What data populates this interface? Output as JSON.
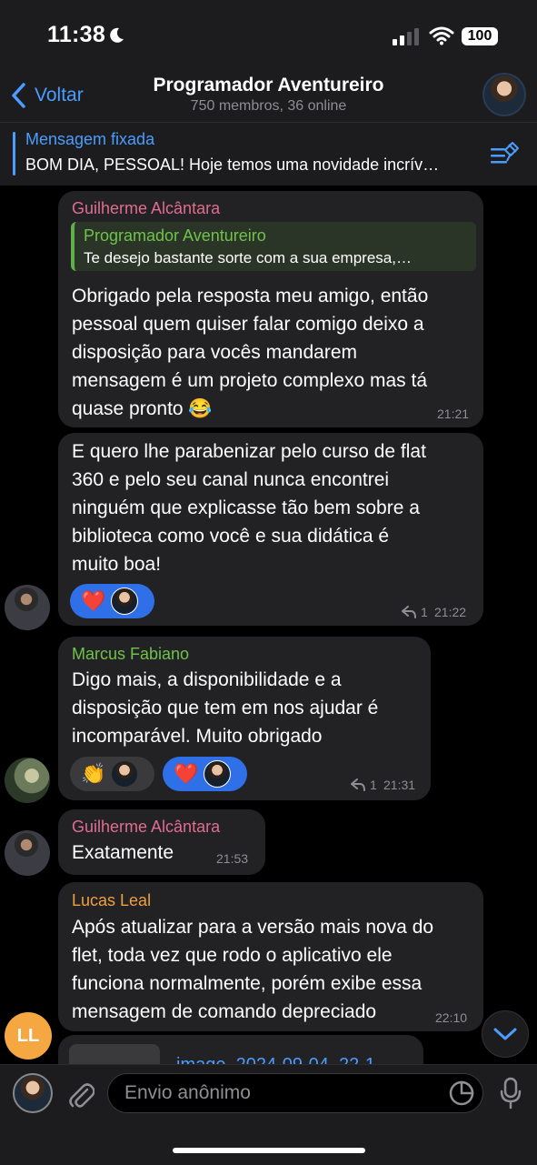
{
  "status": {
    "time": "11:38",
    "battery": "100"
  },
  "header": {
    "back_label": "Voltar",
    "title": "Programador Aventureiro",
    "subtitle": "750 membros, 36 online"
  },
  "pinned": {
    "label": "Mensagem fixada",
    "text": "BOM DIA, PESSOAL! Hoje temos uma novidade incrív…"
  },
  "messages": [
    {
      "sender": "Guilherme Alcântara",
      "sender_color": "#e06c8e",
      "reply_to": {
        "author": "Programador Aventureiro",
        "text": "Te desejo bastante sorte com a sua empresa,…"
      },
      "lines": [
        "Obrigado pela resposta meu amigo, então",
        "pessoal quem quiser falar comigo deixo a",
        "disposição para vocês mandarem",
        "mensagem é um projeto complexo mas tá",
        "quase pronto 😂"
      ],
      "time": "21:21"
    },
    {
      "lines": [
        "E quero lhe parabenizar pelo curso de flat",
        "360 e pelo seu canal nunca encontrei",
        "ninguém que explicasse tão bem sobre a",
        "biblioteca como você e sua didática é",
        "muito boa!"
      ],
      "reaction": "❤️",
      "reply_count": "1",
      "time": "21:22"
    },
    {
      "sender": "Marcus Fabiano",
      "sender_color": "#6fc24a",
      "lines": [
        "Digo mais, a disponibilidade e a",
        "disposição que tem em nos ajudar é",
        "incomparável.  Muito obrigado"
      ],
      "reactions": [
        "👏",
        "❤️"
      ],
      "reply_count": "1",
      "time": "21:31"
    },
    {
      "sender": "Guilherme Alcântara",
      "sender_color": "#e06c8e",
      "text": "Exatamente",
      "time": "21:53"
    },
    {
      "sender": "Lucas Leal",
      "sender_color": "#f0a040",
      "lines": [
        "Após atualizar para a versão mais nova do",
        "flet, toda vez que rodo o aplicativo ele",
        "funciona normalmente, porém exibe essa",
        "mensagem de comando depreciado"
      ],
      "time": "22:10",
      "avatar_initials": "LL"
    },
    {
      "file_partial": "image_2024-09-04_22-1"
    }
  ],
  "input": {
    "placeholder": "Envio anônimo"
  },
  "colors": {
    "accent": "#4a9dff",
    "bubble": "#222224",
    "reaction_blue": "#2f6fe8"
  }
}
